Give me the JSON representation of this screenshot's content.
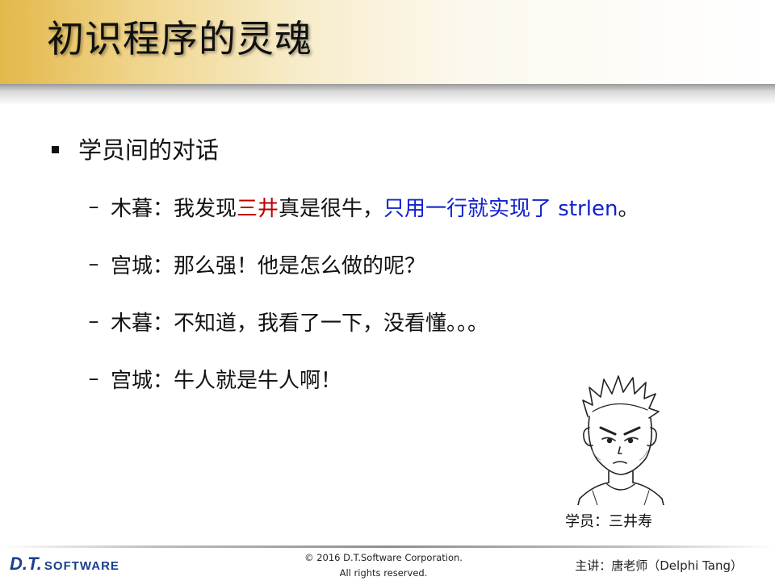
{
  "slide": {
    "title": "初识程序的灵魂",
    "bullet": "学员间的对话",
    "dialogue": [
      {
        "segments": [
          {
            "text": "木暮：我发现",
            "color": "default"
          },
          {
            "text": "三井",
            "color": "red"
          },
          {
            "text": "真是很牛，",
            "color": "default"
          },
          {
            "text": "只用一行就实现了 strlen",
            "color": "blue"
          },
          {
            "text": "。",
            "color": "default"
          }
        ]
      },
      {
        "segments": [
          {
            "text": "宫城：那么强！他是怎么做的呢？",
            "color": "default"
          }
        ]
      },
      {
        "segments": [
          {
            "text": "木暮：不知道，我看了一下，没看懂。。。",
            "color": "default"
          }
        ]
      },
      {
        "segments": [
          {
            "text": "宫城：牛人就是牛人啊！",
            "color": "default"
          }
        ]
      }
    ],
    "dash": "–",
    "portrait_caption": "学员：三井寿"
  },
  "footer": {
    "logo_text": "D.T.",
    "logo_suffix": "SOFTWARE",
    "copyright_line1": "© 2016 D.T.Software Corporation.",
    "copyright_line2": "All rights reserved.",
    "lecturer": "主讲：唐老师（Delphi Tang）"
  },
  "colors": {
    "title_band": "#e2b84a",
    "highlight_red": "#c00000",
    "highlight_blue": "#1122cc",
    "logo_blue": "#1a3f8f"
  },
  "icons": {
    "bullet": "square-bullet-icon",
    "portrait": "student-portrait-sketch"
  }
}
